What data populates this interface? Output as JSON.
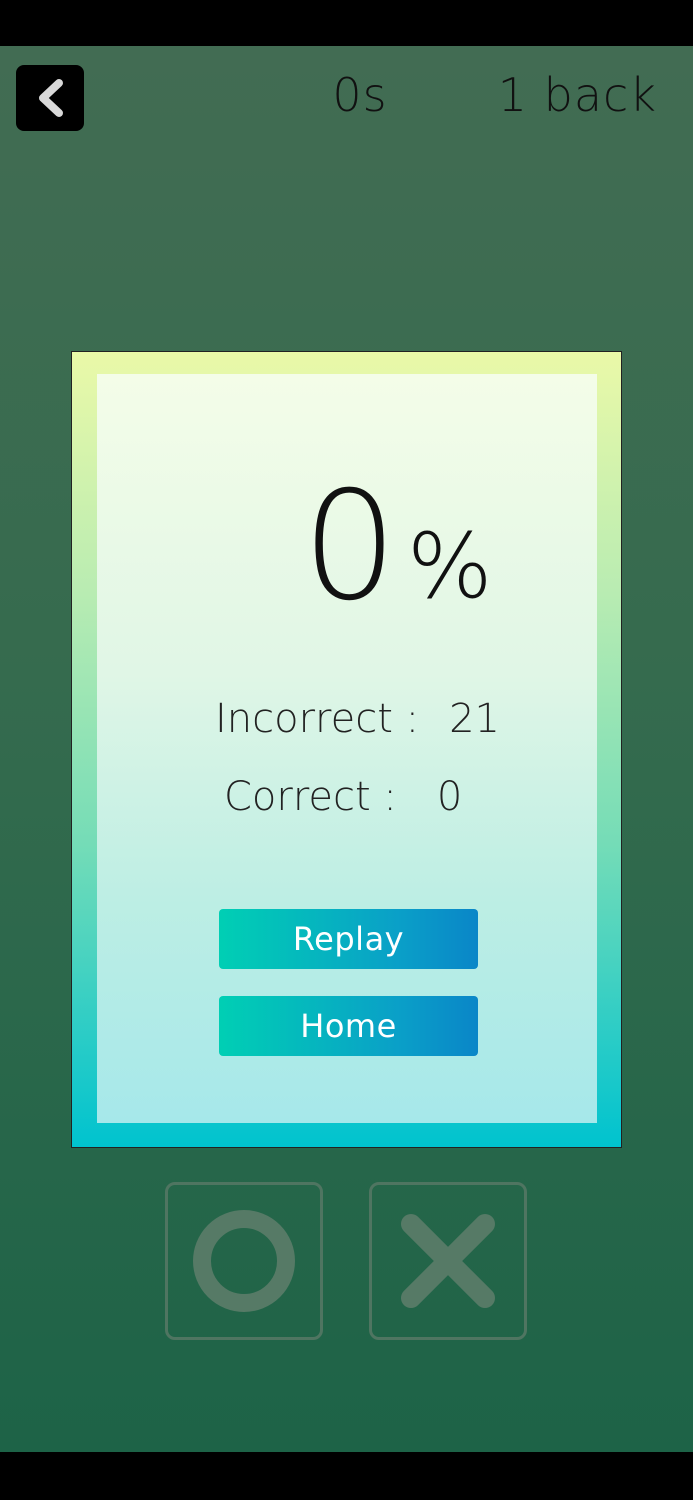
{
  "header": {
    "timer": "0s",
    "nback_label": "1 back"
  },
  "result": {
    "score": "0",
    "score_unit": "%",
    "incorrect_label": "Incorrect :",
    "incorrect_value": "21",
    "correct_label": "Correct :",
    "correct_value": "0",
    "replay_label": "Replay",
    "home_label": "Home"
  },
  "answers": {
    "o_icon": "circle-icon",
    "x_icon": "cross-icon"
  },
  "colors": {
    "button_start": "#00cfb4",
    "button_end": "#0a86c8",
    "answer_icon": "#567a66"
  }
}
